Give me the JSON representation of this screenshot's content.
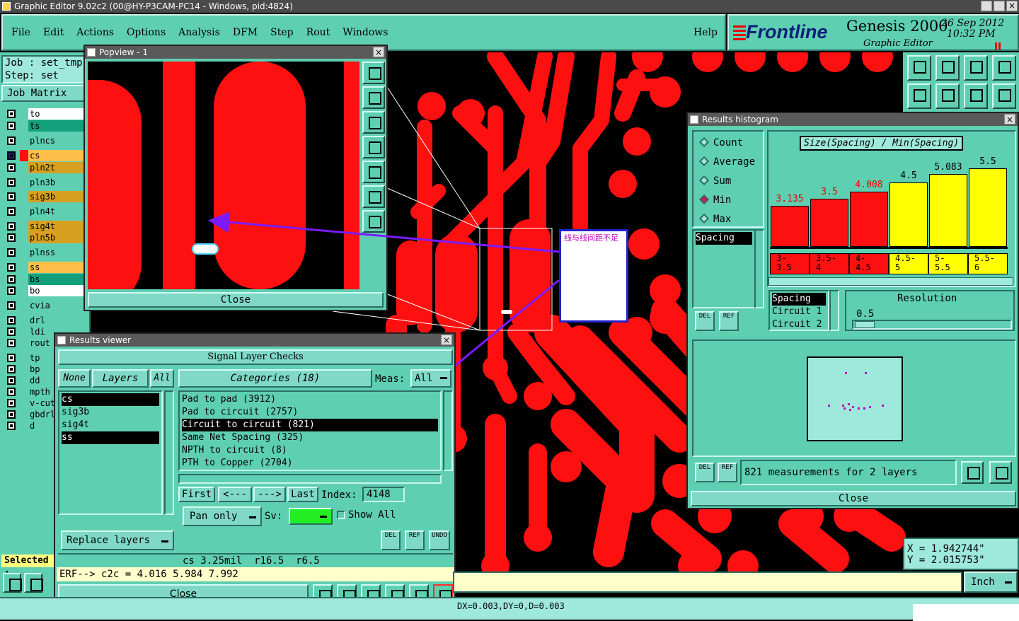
{
  "titlebar": {
    "title": "Graphic Editor 9.02c2 (00@HY-P3CAM-PC14 - Windows, pid:4824)"
  },
  "menu": {
    "items": [
      "File",
      "Edit",
      "Actions",
      "Options",
      "Analysis",
      "DFM",
      "Step",
      "Rout",
      "Windows"
    ],
    "help": "Help"
  },
  "brand": {
    "logo": "Frontline",
    "product": "Genesis 2000",
    "subtitle": "Graphic Editor",
    "date": "26 Sep 2012",
    "time": "10:32 PM"
  },
  "job": {
    "job_label": "Job : set_tmp",
    "step_label": "Step: set",
    "matrix_btn": "Job Matrix ..."
  },
  "layers": [
    {
      "name": "to",
      "color": "#ffffff"
    },
    {
      "name": "ts",
      "color": "#12a07a"
    },
    {
      "name": "plncs",
      "color": "#5fcfb1"
    },
    {
      "name": "cs",
      "color": "#ffc04a"
    },
    {
      "name": "pln2t",
      "color": "#d8a020"
    },
    {
      "name": "pln3b",
      "color": "#5fcfb1"
    },
    {
      "name": "sig3b",
      "color": "#d8a020"
    },
    {
      "name": "pln4t",
      "color": "#5fcfb1"
    },
    {
      "name": "sig4t",
      "color": "#d8a020"
    },
    {
      "name": "pln5b",
      "color": "#d8a020"
    },
    {
      "name": "plnss",
      "color": "#5fcfb1"
    },
    {
      "name": "ss",
      "color": "#ffc04a"
    },
    {
      "name": "bs",
      "color": "#12a07a"
    },
    {
      "name": "bo",
      "color": "#ffffff"
    },
    {
      "name": "cvia",
      "color": "#5fcfb1"
    },
    {
      "name": "drl",
      "color": "#5fcfb1"
    },
    {
      "name": "ldi",
      "color": "#5fcfb1"
    },
    {
      "name": "rout",
      "color": "#5fcfb1"
    },
    {
      "name": "tp",
      "color": "#5fcfb1"
    },
    {
      "name": "bp",
      "color": "#5fcfb1"
    },
    {
      "name": "dd",
      "color": "#5fcfb1"
    },
    {
      "name": "mpth",
      "color": "#5fcfb1"
    },
    {
      "name": "v-cut",
      "color": "#5fcfb1"
    },
    {
      "name": "gbdrl",
      "color": "#5fcfb1"
    },
    {
      "name": "d",
      "color": "#5fcfb1"
    }
  ],
  "selected_label": "Selected :",
  "popview": {
    "title": "Popview - 1",
    "close": "Close"
  },
  "annotation": {
    "text": "线与线间距不足"
  },
  "histogram": {
    "title": "Results histogram",
    "options": [
      "Count",
      "Average",
      "Sum",
      "Min",
      "Max"
    ],
    "selected_option": "Min",
    "chart_title": "Size(Spacing) / Min(Spacing)",
    "bars": [
      {
        "value": "3.135",
        "range": "3-\n3.5",
        "color": "#ff1010",
        "frac": 0.46
      },
      {
        "value": "3.5",
        "range": "3.5-\n4",
        "color": "#ff1010",
        "frac": 0.54
      },
      {
        "value": "4.008",
        "range": "4-\n4.5",
        "color": "#ff1010",
        "frac": 0.62
      },
      {
        "value": "4.5",
        "range": "4.5-\n5",
        "color": "#ffff00",
        "frac": 0.72
      },
      {
        "value": "5.083",
        "range": "5-\n5.5",
        "color": "#ffff00",
        "frac": 0.82
      },
      {
        "value": "5.5",
        "range": "5.5-\n6",
        "color": "#ffff00",
        "frac": 0.88
      }
    ],
    "list1": [
      "Spacing"
    ],
    "list2": [
      "Spacing",
      "Circuit 1",
      "Circuit 2"
    ],
    "resolution_label": "Resolution",
    "resolution_value": "0.5",
    "status": "821 measurements for 2 layers",
    "close": "Close"
  },
  "results": {
    "title": "Results viewer",
    "header": "Signal Layer Checks",
    "none_btn": "None",
    "layers_btn": "Layers",
    "all_btn": "All",
    "categories_btn": "Categories (18)",
    "meas_label": "Meas:",
    "meas_value": "All",
    "layer_list": [
      "cs",
      "sig3b",
      "sig4t",
      "ss"
    ],
    "selected_layers": [
      "cs",
      "ss"
    ],
    "categories": [
      "Pad to pad (3912)",
      "Pad to circuit (2757)",
      "Circuit to circuit (821)",
      "Same Net Spacing (325)",
      "NPTH to circuit (8)",
      "PTH to Copper (2704)"
    ],
    "selected_category": "Circuit to circuit (821)",
    "first": "First",
    "prev": "<---",
    "next": "--->",
    "last": "Last",
    "index_label": "Index:",
    "index_value": "4148",
    "pan_only": "Pan only",
    "sv_label": "Sv:",
    "show_all": "Show All",
    "replace_layers": "Replace layers",
    "info": "cs 3.25mil  r16.5  r6.5",
    "erf": "ERF--> c2c = 4.016 5.984 7.992",
    "close": "Close"
  },
  "coords": {
    "x": "X = 1.942744\"",
    "y": "Y = 2.015753\""
  },
  "units": "Inch",
  "status_bar": "DX=0.003,DY=0,D=0.003"
}
